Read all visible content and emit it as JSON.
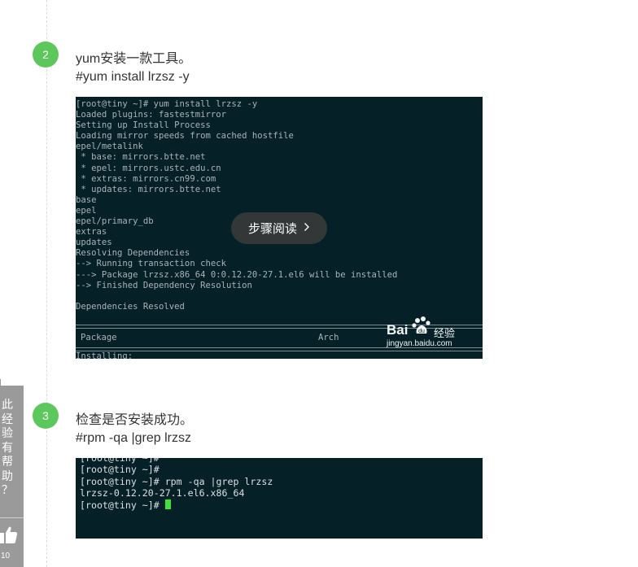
{
  "steps": [
    {
      "number": "2",
      "description": "yum安装一款工具。",
      "command": "#yum install  lrzsz -y",
      "terminal_lines": [
        "[root@tiny ~]# yum install lrzsz -y",
        "Loaded plugins: fastestmirror",
        "Setting up Install Process",
        "Loading mirror speeds from cached hostfile",
        "epel/metalink",
        " * base: mirrors.btte.net",
        " * epel: mirrors.ustc.edu.cn",
        " * extras: mirrors.cn99.com",
        " * updates: mirrors.btte.net",
        "base",
        "epel",
        "epel/primary_db",
        "extras",
        "updates",
        "Resolving Dependencies",
        "--> Running transaction check",
        "---> Package lrzsz.x86_64 0:0.12.20-27.1.el6 will be installed",
        "--> Finished Dependency Resolution",
        "",
        "Dependencies Resolved"
      ],
      "table_header": {
        "package": "Package",
        "arch": "Arch"
      },
      "partial_line": "Installing:",
      "overlay_button": "步骤阅读",
      "watermark": {
        "brand": "Bai",
        "brand_suffix": "经验",
        "url": "jingyan.baidu.com"
      }
    },
    {
      "number": "3",
      "description": "检查是否安装成功。",
      "command": "#rpm -qa |grep lrzsz",
      "terminal_lines": [
        "[root@tiny ~]#",
        "[root@tiny ~]#",
        "[root@tiny ~]# rpm -qa |grep lrzsz",
        "lrzsz-0.12.20-27.1.el6.x86_64"
      ],
      "prompt_line": "[root@tiny ~]# "
    }
  ],
  "feedback": {
    "label_chars": [
      "此",
      "经",
      "验",
      "有",
      "帮",
      "助",
      "？"
    ],
    "like_count": "10"
  },
  "colors": {
    "step_badge": "#5cc85c",
    "terminal_bg": "#062027",
    "cursor": "#3fe03f",
    "feedback_bar": "#9a9a9a"
  }
}
